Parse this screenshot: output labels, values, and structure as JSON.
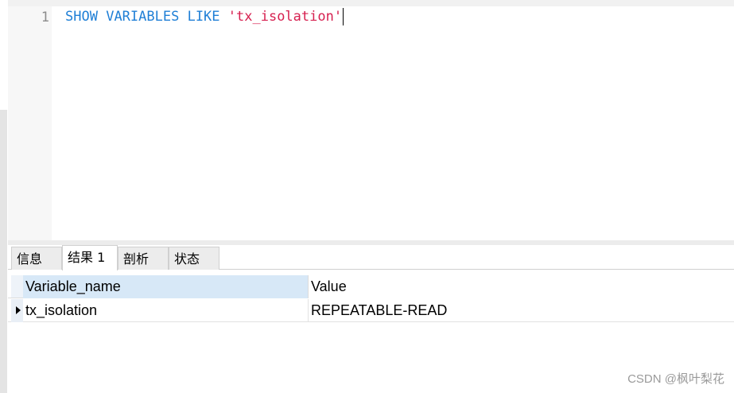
{
  "editor": {
    "line_number": "1",
    "keyword_1": "SHOW",
    "keyword_2": "VARIABLES",
    "keyword_3": "LIKE",
    "string_literal": "'tx_isolation'"
  },
  "tabs": [
    {
      "label": "信息"
    },
    {
      "label": "结果 1"
    },
    {
      "label": "剖析"
    },
    {
      "label": "状态"
    }
  ],
  "active_tab": "结果 1",
  "results": {
    "columns": [
      "Variable_name",
      "Value"
    ],
    "rows": [
      [
        "tx_isolation",
        "REPEATABLE-READ"
      ]
    ]
  },
  "watermark": "CSDN @枫叶梨花",
  "colors": {
    "keyword": "#1f7fd6",
    "string": "#d61f4f",
    "selected_header": "#d7e8f7"
  }
}
